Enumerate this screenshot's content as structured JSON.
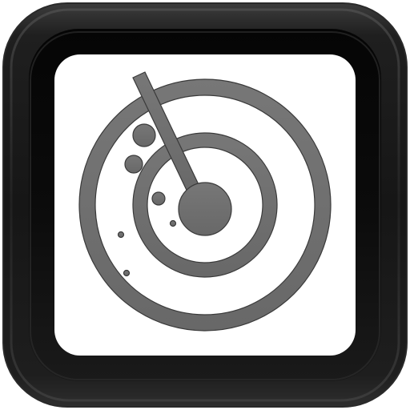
{
  "icon": {
    "name": "radar-icon",
    "frame_color": "#141414",
    "frame_highlight": "#4a4a4a",
    "screen_color": "#ffffff",
    "glyph_color": "#6e6e6e",
    "glyph_outline": "#3a3a3a"
  }
}
